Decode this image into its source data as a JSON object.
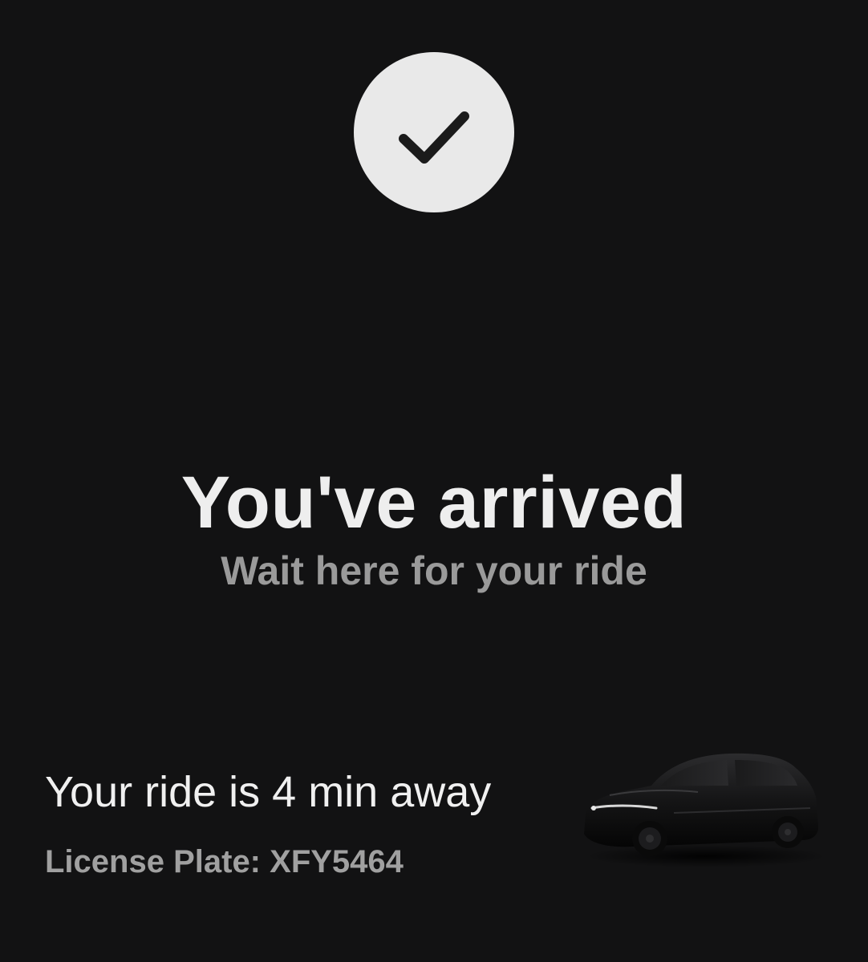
{
  "status": {
    "icon": "checkmark-icon",
    "circle_color": "#e9e9e9",
    "check_color": "#1b1b1b"
  },
  "arrival": {
    "title": "You've arrived",
    "subtitle": "Wait here for your ride"
  },
  "ride": {
    "eta_text": "Your ride is 4 min away",
    "plate_label": "License Plate:",
    "plate_value": "XFY5464",
    "vehicle_icon": "car-icon"
  },
  "colors": {
    "background": "#121213",
    "title_text": "#eeeeee",
    "subtitle_text": "#9a9a9a"
  }
}
